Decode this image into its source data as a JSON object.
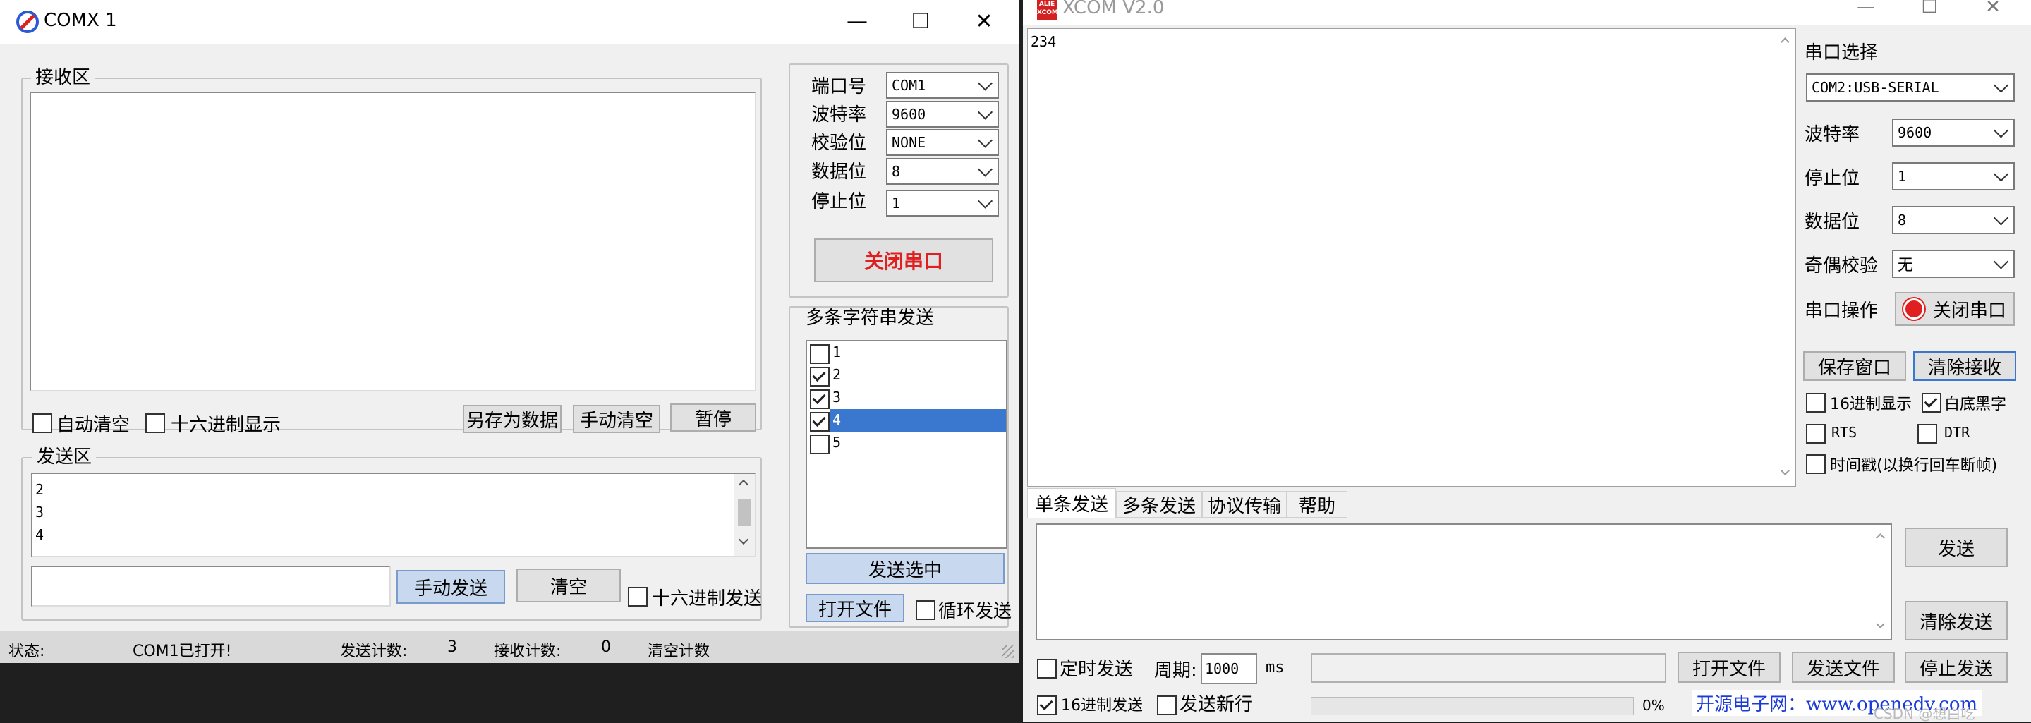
{
  "comx": {
    "title": "COMX 1",
    "logo_icon": "comx-logo-icon",
    "controls": {
      "minimize": "—",
      "maximize": "☐",
      "close": "✕"
    },
    "receive_area": {
      "label": "接收区",
      "content": ""
    },
    "options": {
      "auto_clear": "自动清空",
      "hex_display": "十六进制显示"
    },
    "buttons": {
      "save_as": "另存为数据",
      "manual_clear": "手动清空",
      "pause": "暂停"
    },
    "send_area": {
      "label": "发送区",
      "lines": [
        "2",
        "3",
        "4"
      ]
    },
    "manual_send": "手动发送",
    "clear": "清空",
    "hex_send": "十六进制发送",
    "port_settings": [
      {
        "label": "端口号",
        "value": "COM1"
      },
      {
        "label": "波特率",
        "value": "9600"
      },
      {
        "label": "校验位",
        "value": "NONE"
      },
      {
        "label": "数据位",
        "value": "8"
      },
      {
        "label": "停止位",
        "value": "1"
      }
    ],
    "close_port": "关闭串口",
    "multi_send": {
      "label": "多条字符串发送",
      "items": [
        {
          "text": "1",
          "checked": false,
          "selected": false
        },
        {
          "text": "2",
          "checked": true,
          "selected": false
        },
        {
          "text": "3",
          "checked": true,
          "selected": false
        },
        {
          "text": "4",
          "checked": true,
          "selected": true
        },
        {
          "text": "5",
          "checked": false,
          "selected": false
        }
      ],
      "send_selected": "发送选中",
      "open_file": "打开文件",
      "loop_send": "循环发送"
    },
    "status": {
      "label": "状态:",
      "message": "COM1已打开!",
      "sent_label": "发送计数:",
      "sent_value": "3",
      "recv_label": "接收计数:",
      "recv_value": "0",
      "clear_count": "清空计数"
    }
  },
  "xcom": {
    "title": "XCOM V2.0",
    "logo_text_top": "ALIE",
    "logo_text_bottom": "XCOM",
    "controls": {
      "minimize": "—",
      "maximize": "☐",
      "close": "✕"
    },
    "receive_text": "234",
    "port_select_label": "串口选择",
    "port_select_value": "COM2:USB-SERIAL",
    "settings": [
      {
        "label": "波特率",
        "value": "9600"
      },
      {
        "label": "停止位",
        "value": "1"
      },
      {
        "label": "数据位",
        "value": "8"
      },
      {
        "label": "奇偶校验",
        "value": "无"
      }
    ],
    "port_op_label": "串口操作",
    "close_port": "关闭串口",
    "save_window": "保存窗口",
    "clear_receive": "清除接收",
    "hex_display": "16进制显示",
    "white_black": "白底黑字",
    "rts": "RTS",
    "dtr": "DTR",
    "timestamp": "时间戳(以换行回车断帧)",
    "tabs": [
      "单条发送",
      "多条发送",
      "协议传输",
      "帮助"
    ],
    "send_button": "发送",
    "clear_send": "清除发送",
    "timed_send": "定时发送",
    "period_label": "周期:",
    "period_value": "1000",
    "period_unit": "ms",
    "open_file": "打开文件",
    "send_file": "发送文件",
    "stop_send": "停止发送",
    "hex_send": "16进制发送",
    "send_newline": "发送新行",
    "progress_percent": 0,
    "progress_label": "0%",
    "footer_brand": "开源电子网：www.openedv.com",
    "watermark": "CSDN @想白吃"
  }
}
